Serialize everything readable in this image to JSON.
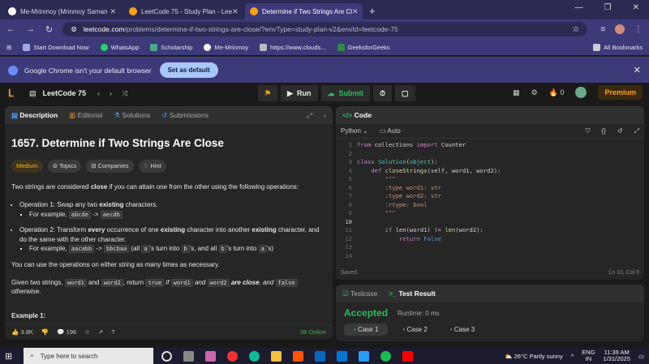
{
  "browser": {
    "tabs": [
      {
        "title": "Me-Mrinmoy (Mrinmoy Saman",
        "color": "#ffffff"
      },
      {
        "title": "LeetCode 75 - Study Plan - Lee",
        "color": "#ffa116"
      },
      {
        "title": "Determine if Two Strings Are Cl",
        "color": "#ffa116"
      }
    ],
    "url_host": "leetcode.com",
    "url_rest": "/problems/determine-if-two-strings-are-close/?envType=study-plan-v2&envId=leetcode-75",
    "bookmarks": [
      "Start Download Now",
      "WhatsApp",
      "Scholarship",
      "Me-Mrinmoy",
      "https://www.clouds...",
      "GeeksforGeeks"
    ],
    "all_bookmarks": "All Bookmarks",
    "infobar_text": "Google Chrome isn't your default browser",
    "infobar_button": "Set as default"
  },
  "leetcode": {
    "study_title": "LeetCode 75",
    "run_label": "Run",
    "submit_label": "Submit",
    "fire_count": "0",
    "premium_label": "Premium"
  },
  "left": {
    "tabs": [
      "Description",
      "Editorial",
      "Solutions",
      "Submissions"
    ],
    "title": "1657. Determine if Two Strings Are Close",
    "tags": [
      "Medium",
      "Topics",
      "Companies",
      "Hint"
    ],
    "p1a": "Two strings are considered ",
    "p1b": "close",
    "p1c": " if you can attain one from the other using the following operations:",
    "op1a": "Operation 1: Swap any two ",
    "op1b": "existing",
    "op1c": " characters.",
    "op1ex": "For example, ",
    "op1code1": "abcde",
    "op1arrow": " -> ",
    "op1code2": "aecdb",
    "op2a": "Operation 2: Transform ",
    "op2b": "every",
    "op2c": " occurrence of one ",
    "op2d": "existing",
    "op2e": " character into another ",
    "op2f": "existing",
    "op2g": " character, and do the same with the other character.",
    "op2ex": "For example, ",
    "op2code1": "aacabb",
    "op2arrow": " -> ",
    "op2code2": "bbcbaa",
    "op2rest1": " (all ",
    "op2a_char": "a",
    "op2rest2": "'s turn into ",
    "op2b_char": "b",
    "op2rest3": "'s, and all ",
    "op2b_char2": "b",
    "op2rest4": "'s turn into ",
    "op2a_char2": "a",
    "op2rest5": "'s)",
    "p2": "You can use the operations on either string as many times as necessary.",
    "p3a": "Given two strings, ",
    "p3w1": "word1",
    "p3b": " and ",
    "p3w2": "word2",
    "p3c": ", return ",
    "p3t": "true",
    "p3d": " if ",
    "p3w1b": "word1",
    "p3e": " and ",
    "p3w2b": "word2",
    "p3f": " are close",
    "p3g": ", and ",
    "p3false": "false",
    "p3h": " otherwise.",
    "example": "Example 1:",
    "likes": "3.8K",
    "comments": "196",
    "online": "39 Online"
  },
  "code": {
    "header": "Code",
    "language": "Python",
    "auto": "Auto",
    "saved": "Saved",
    "position": "Ln 10, Col 9",
    "lines": [
      "from collections import Counter",
      "",
      "class Solution(object):",
      "    def closeStrings(self, word1, word2):",
      "        \"\"\"",
      "        :type word1: str",
      "        :type word2: str",
      "        :rtype: bool",
      "        \"\"\"",
      "",
      "        if len(word1) != len(word2):",
      "            return False",
      "",
      ""
    ]
  },
  "result": {
    "tabs": [
      "Testcase",
      "Test Result"
    ],
    "status": "Accepted",
    "runtime": "Runtime: 0 ms",
    "cases": [
      "Case 1",
      "Case 2",
      "Case 3"
    ]
  },
  "taskbar": {
    "search_placeholder": "Type here to search",
    "weather": "26°C  Partly sunny",
    "lang1": "ENG",
    "lang2": "IN",
    "time": "11:39 AM",
    "date": "1/31/2025"
  }
}
